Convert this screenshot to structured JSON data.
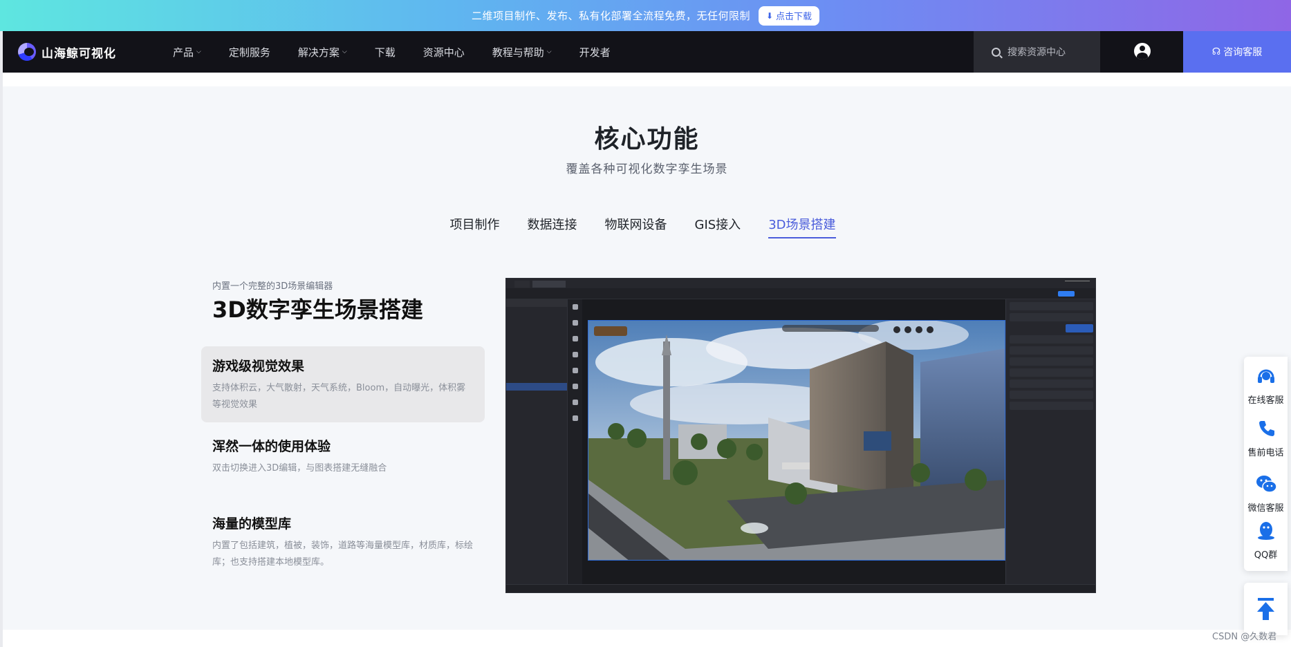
{
  "banner": {
    "text": "二维项目制作、发布、私有化部署全流程免费，无任何限制",
    "button": "点击下载"
  },
  "nav": {
    "logo": "山海鲸可视化",
    "items": [
      {
        "label": "产品",
        "dropdown": true
      },
      {
        "label": "定制服务",
        "dropdown": false
      },
      {
        "label": "解决方案",
        "dropdown": true
      },
      {
        "label": "下载",
        "dropdown": false
      },
      {
        "label": "资源中心",
        "dropdown": false
      },
      {
        "label": "教程与帮助",
        "dropdown": true
      },
      {
        "label": "开发者",
        "dropdown": false
      }
    ],
    "search_placeholder": "搜索资源中心",
    "consult": "咨询客服"
  },
  "section": {
    "title": "核心功能",
    "subtitle": "覆盖各种可视化数字孪生场景",
    "tabs": [
      "项目制作",
      "数据连接",
      "物联网设备",
      "GIS接入",
      "3D场景搭建"
    ],
    "active_tab": "3D场景搭建"
  },
  "feature": {
    "caption": "内置一个完整的3D场景编辑器",
    "title": "3D数字孪生场景搭建",
    "cards": [
      {
        "title": "游戏级视觉效果",
        "desc": "支持体积云，大气散射，天气系统，Bloom，自动曝光，体积雾等视觉效果",
        "active": true
      },
      {
        "title": "浑然一体的使用体验",
        "desc": "双击切换进入3D编辑，与图表搭建无缝融合",
        "active": false
      },
      {
        "title": "海量的模型库",
        "desc": "内置了包括建筑，植被，装饰，道路等海量模型库，材质库，标绘库；也支持搭建本地模型库。",
        "active": false
      }
    ]
  },
  "float": {
    "items": [
      {
        "label": "在线客服",
        "icon": "headset-icon"
      },
      {
        "label": "售前电话",
        "icon": "phone-icon"
      },
      {
        "label": "微信客服",
        "icon": "wechat-icon"
      },
      {
        "label": "QQ群",
        "icon": "qq-icon"
      }
    ],
    "top_icon": "back-to-top-icon"
  },
  "watermark": "CSDN @久数君",
  "colors": {
    "accent": "#4a5cdb",
    "nav_bg": "#121218",
    "consult_bg": "#5a6ff0",
    "float_icon": "#1a6fe8"
  }
}
